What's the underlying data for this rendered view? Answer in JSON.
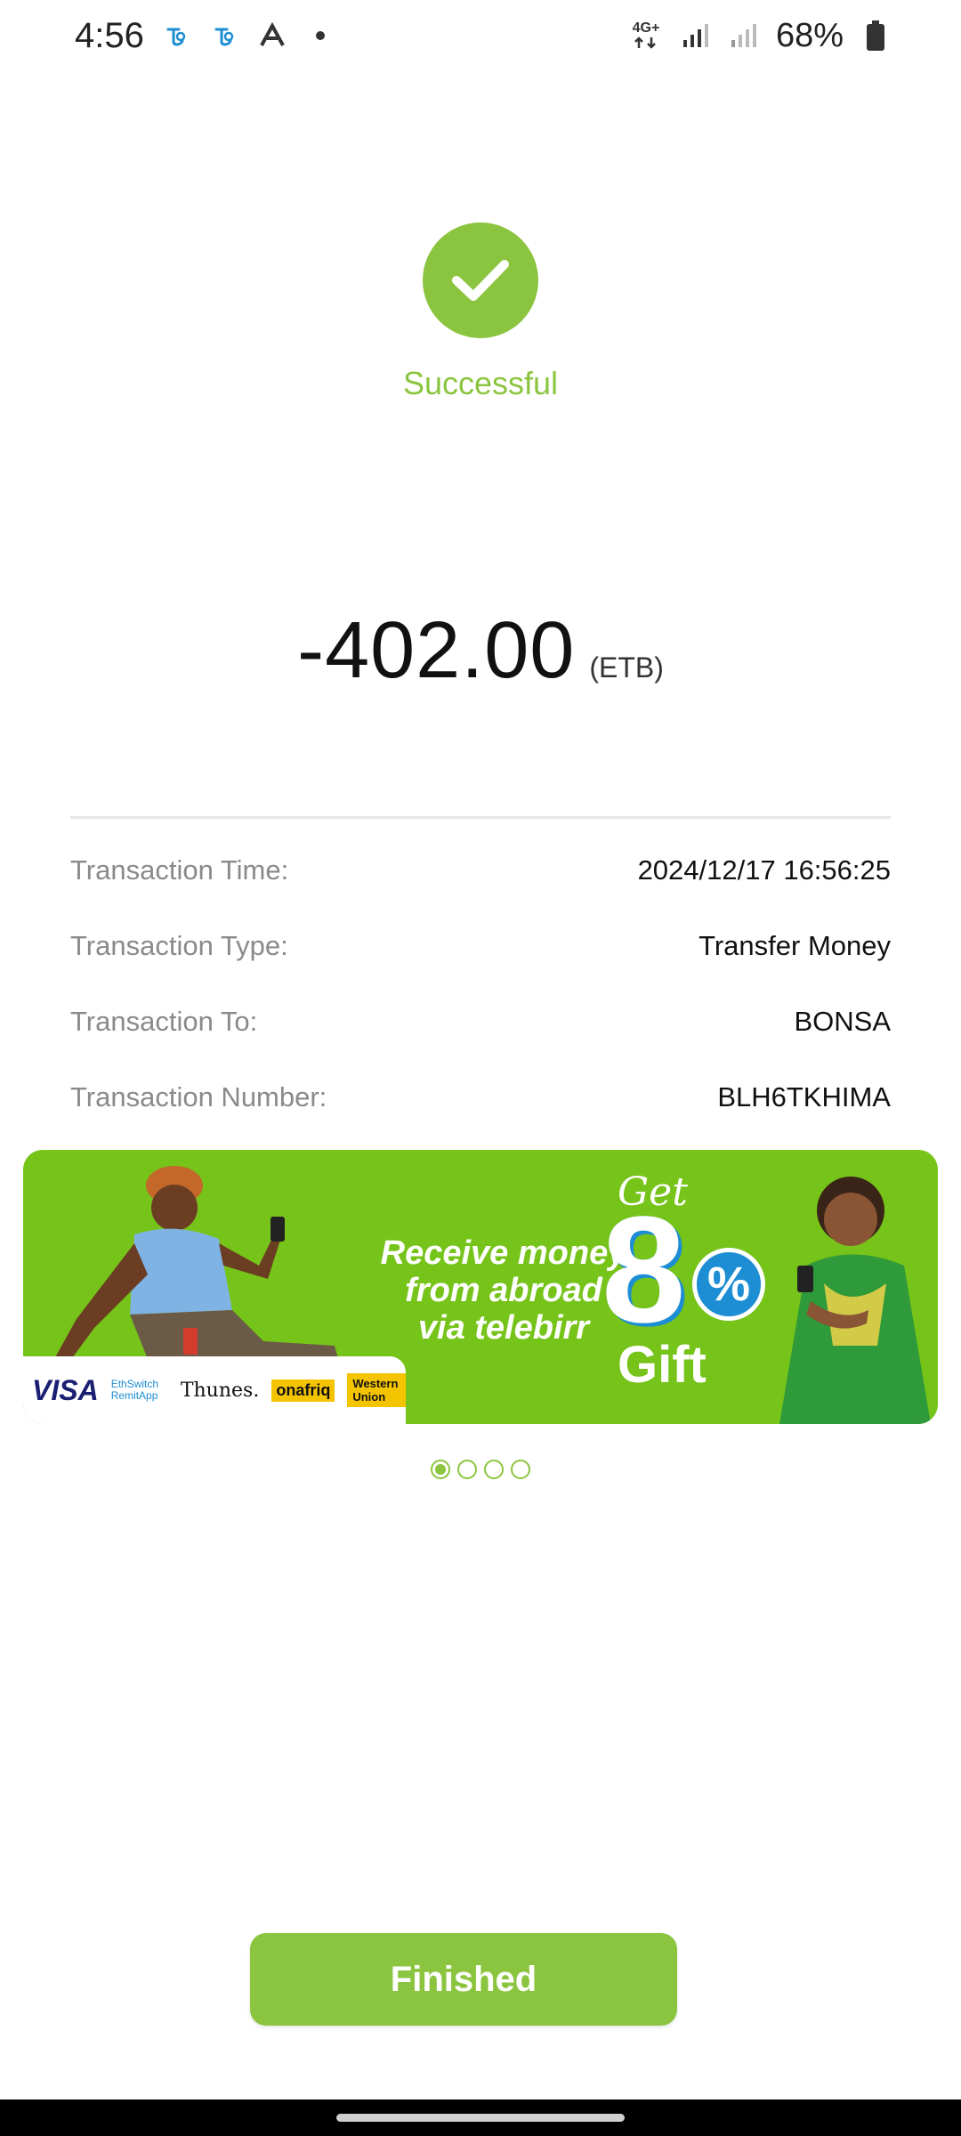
{
  "status_bar": {
    "time": "4:56",
    "icons_left": [
      "telebirr-icon",
      "telebirr-icon",
      "autopilot-icon",
      "dot-icon"
    ],
    "network": "4G+",
    "battery": "68%"
  },
  "success": {
    "icon": "check-icon",
    "label": "Successful",
    "color": "#8bc53f"
  },
  "amount": {
    "value": "-402.00",
    "currency": "(ETB)"
  },
  "details": [
    {
      "label": "Transaction Time:",
      "value": "2024/12/17 16:56:25"
    },
    {
      "label": "Transaction Type:",
      "value": "Transfer Money"
    },
    {
      "label": "Transaction To:",
      "value": "BONSA"
    },
    {
      "label": "Transaction Number:",
      "value": "BLH6TKHIMA"
    }
  ],
  "banner": {
    "text_line1": "Receive money",
    "text_line2": "from abroad",
    "text_line3": "via telebirr",
    "get": "Get",
    "big_number": "8",
    "percent": "%",
    "gift": "Gift",
    "logos": {
      "visa": "VISA",
      "ethswitch": "EthSwitch RemitApp",
      "thunes": "Thunes.",
      "onafriq": "onafriq",
      "western_union": "Western Union"
    },
    "bg_color": "#76c31a"
  },
  "carousel": {
    "count": 4,
    "active_index": 0
  },
  "finish_button": {
    "label": "Finished"
  }
}
